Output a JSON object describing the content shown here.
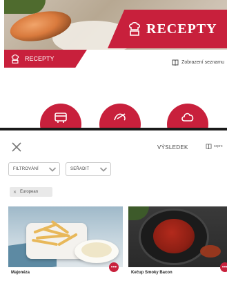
{
  "top_screen": {
    "hero_title": "RECEPTY",
    "tab_label": "RECEPTY",
    "list_view_label": "Zobrazení seznamu",
    "categories": [
      "scale-icon",
      "chef-icon",
      "cloud-icon"
    ]
  },
  "bottom_screen": {
    "result_label": "VÝSLEDEK",
    "open_label": "sopro",
    "filter_label": "FILTROVÁNÍ",
    "sort_label": "SEŘADIT",
    "active_filter_chip": "European",
    "recipes": [
      {
        "title": "Majonéza"
      },
      {
        "title": "Kečup Smoky Bacon"
      }
    ]
  },
  "colors": {
    "accent": "#c8203c",
    "chip_bg": "#e9e9e9"
  }
}
